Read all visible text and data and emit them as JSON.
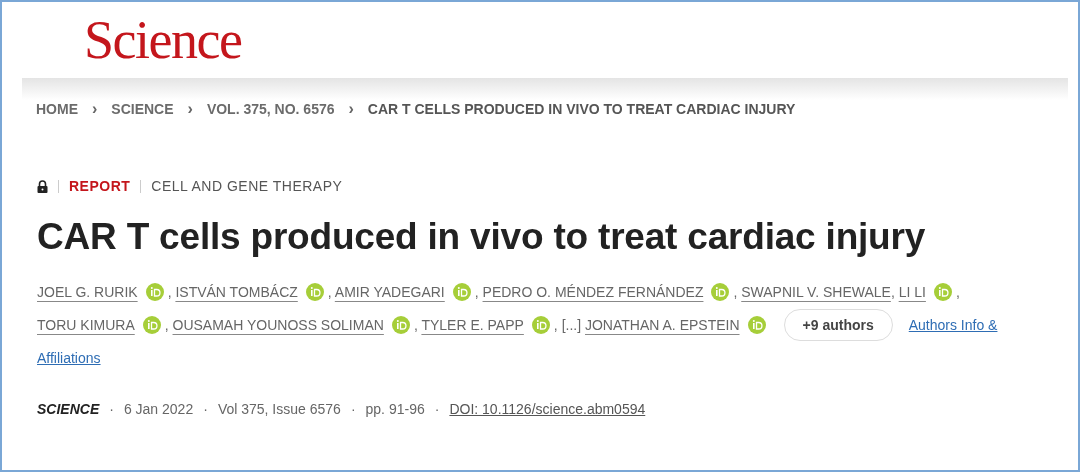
{
  "logo": "Science",
  "breadcrumb": {
    "separator": "›",
    "items": [
      "HOME",
      "SCIENCE",
      "VOL. 375, NO. 6576",
      "CAR T CELLS PRODUCED IN VIVO TO TREAT CARDIAC INJURY"
    ]
  },
  "article": {
    "locked": true,
    "type": "REPORT",
    "section": "CELL AND GENE THERAPY",
    "title": "CAR T cells produced in vivo to treat cardiac injury",
    "author_lines": [
      [
        {
          "kind": "author",
          "name": "JOEL G. RURIK",
          "orcid": true,
          "after": ","
        },
        {
          "kind": "author",
          "name": "ISTVÁN TOMBÁCZ",
          "orcid": true,
          "after": ","
        },
        {
          "kind": "author",
          "name": "AMIR YADEGARI",
          "orcid": true,
          "after": ","
        },
        {
          "kind": "author",
          "name": "PEDRO O. MÉNDEZ FERNÁNDEZ",
          "orcid": true,
          "after": ","
        },
        {
          "kind": "author",
          "name": "SWAPNIL V. SHEWALE",
          "orcid": false,
          "after": ","
        },
        {
          "kind": "author",
          "name": "LI LI",
          "orcid": true,
          "after": ","
        }
      ],
      [
        {
          "kind": "author",
          "name": "TORU KIMURA",
          "orcid": true,
          "after": ","
        },
        {
          "kind": "author",
          "name": "OUSAMAH YOUNOSS SOLIMAN",
          "orcid": true,
          "after": ","
        },
        {
          "kind": "author",
          "name": "TYLER E. PAPP",
          "orcid": true,
          "after": ","
        },
        {
          "kind": "ellipsis",
          "name": "[...]"
        },
        {
          "kind": "author",
          "name": "JONATHAN A. EPSTEIN",
          "orcid": true
        }
      ]
    ],
    "more_authors": "+9 authors",
    "info_link_lines": [
      "Authors Info &",
      "Affiliations"
    ],
    "meta": {
      "separator": "·",
      "journal": "SCIENCE",
      "items": [
        "6 Jan 2022",
        "Vol 375, Issue 6576",
        "pp. 91-96"
      ],
      "doi": "DOI: 10.1126/science.abm0594"
    }
  }
}
